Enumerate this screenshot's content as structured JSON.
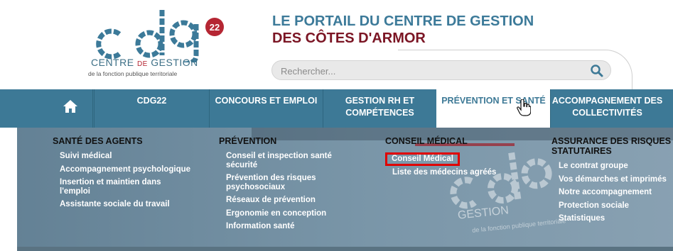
{
  "logo": {
    "mark_text": "cdg",
    "number": "22",
    "line1_a": "CENTRE",
    "line1_b": "DE",
    "line1_c": "GESTION",
    "line2": "de la fonction publique territoriale"
  },
  "site_title": {
    "line1": "LE PORTAIL DU CENTRE DE GESTION",
    "line2": "DES CÔTES D'ARMOR"
  },
  "search": {
    "placeholder": "Rechercher..."
  },
  "nav": {
    "home_icon": "home-icon",
    "items": [
      {
        "label": "CDG22"
      },
      {
        "label": "CONCOURS ET EMPLOI"
      },
      {
        "label_1": "GESTION RH ET",
        "label_2": "COMPÉTENCES"
      },
      {
        "label": "PRÉVENTION ET SANTÉ"
      },
      {
        "label_1": "ACCOMPAGNEMENT DES",
        "label_2": "COLLECTIVITÉS"
      }
    ]
  },
  "mega_menu": {
    "columns": [
      {
        "heading": "SANTÉ DES AGENTS",
        "links": [
          "Suivi médical",
          "Accompagnement psychologique",
          "Insertion et maintien dans l'emploi",
          "Assistante sociale du travail"
        ]
      },
      {
        "heading": "PRÉVENTION",
        "links": [
          "Conseil et inspection santé sécurité",
          "Prévention des risques psychosociaux",
          "Réseaux de prévention",
          "Ergonomie en conception",
          "Information santé"
        ]
      },
      {
        "heading": "CONSEIL MÉDICAL",
        "links": [
          "Conseil Médical",
          "Liste des médecins agréés"
        ]
      },
      {
        "heading": "ASSURANCE DES RISQUES STATUTAIRES",
        "links": [
          "Le contrat groupe",
          "Vos démarches et imprimés",
          "Notre accompagnement",
          "Protection sociale",
          "Statistiques"
        ]
      }
    ]
  },
  "colors": {
    "nav_bg": "#3d7996",
    "title_blue": "#3c7a99",
    "title_red": "#7b1524",
    "highlight_box": "#e00000"
  }
}
